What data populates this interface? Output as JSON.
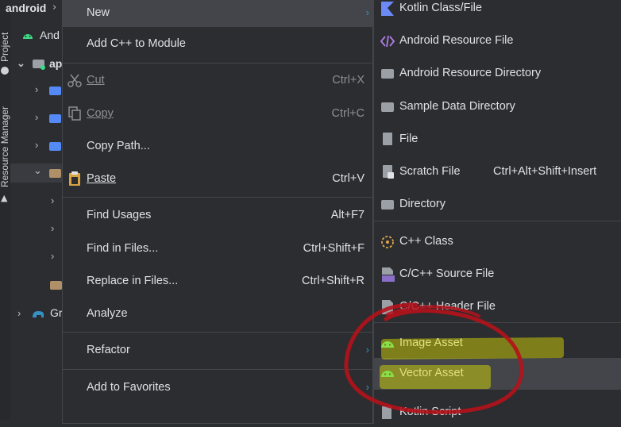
{
  "project": {
    "title": "android",
    "side_tabs": [
      "Project",
      "Resource Manager"
    ],
    "tree": [
      {
        "label": "And",
        "depth": 0,
        "icon": "android-icon"
      },
      {
        "label": "ap",
        "depth": 0,
        "icon": "module-folder-icon"
      },
      {
        "label": "",
        "depth": 1,
        "icon": "folder-icon"
      },
      {
        "label": "",
        "depth": 1,
        "icon": "folder-icon"
      },
      {
        "label": "",
        "depth": 1,
        "icon": "resource-folder-icon"
      },
      {
        "label": "",
        "depth": 1,
        "icon": "folder-icon"
      },
      {
        "label": "",
        "depth": 2,
        "icon": "folder-icon"
      },
      {
        "label": "",
        "depth": 2,
        "icon": "folder-icon"
      },
      {
        "label": "",
        "depth": 2,
        "icon": "folder-icon"
      },
      {
        "label": "",
        "depth": 1,
        "icon": "folder-icon"
      },
      {
        "label": "Gr",
        "depth": 0,
        "icon": "gradle-icon"
      }
    ]
  },
  "context_menu": {
    "items": [
      {
        "label": "New",
        "shortcut": "",
        "submenu": true,
        "highlighted": true
      },
      {
        "label": "Add C++ to Module",
        "shortcut": ""
      },
      {
        "label": "Cut",
        "shortcut": "Ctrl+X",
        "disabled": true,
        "icon": "scissors-icon"
      },
      {
        "label": "Copy",
        "shortcut": "Ctrl+C",
        "disabled": true,
        "icon": "copy-icon"
      },
      {
        "label": "Copy Path...",
        "shortcut": ""
      },
      {
        "label": "Paste",
        "shortcut": "Ctrl+V",
        "icon": "clipboard-icon"
      },
      {
        "label": "Find Usages",
        "shortcut": "Alt+F7"
      },
      {
        "label": "Find in Files...",
        "shortcut": "Ctrl+Shift+F"
      },
      {
        "label": "Replace in Files...",
        "shortcut": "Ctrl+Shift+R"
      },
      {
        "label": "Analyze",
        "shortcut": ""
      },
      {
        "label": "Refactor",
        "shortcut": "",
        "submenu": true
      },
      {
        "label": "Add to Favorites",
        "shortcut": "",
        "submenu": true
      }
    ]
  },
  "new_submenu": {
    "items": [
      {
        "label": "Kotlin Class/File",
        "shortcut": "",
        "icon": "kotlin-icon"
      },
      {
        "label": "Android Resource File",
        "shortcut": "",
        "icon": "code-brackets-icon"
      },
      {
        "label": "Android Resource Directory",
        "shortcut": "",
        "icon": "folder-icon"
      },
      {
        "label": "Sample Data Directory",
        "shortcut": "",
        "icon": "folder-icon"
      },
      {
        "label": "File",
        "shortcut": "",
        "icon": "file-icon"
      },
      {
        "label": "Scratch File",
        "shortcut": "Ctrl+Alt+Shift+Insert",
        "icon": "scratch-file-icon"
      },
      {
        "label": "Directory",
        "shortcut": "",
        "icon": "folder-icon"
      },
      {
        "label": "C++ Class",
        "shortcut": "",
        "icon": "cpp-class-icon"
      },
      {
        "label": "C/C++ Source File",
        "shortcut": "",
        "icon": "cpp-source-icon"
      },
      {
        "label": "C/C++ Header File",
        "shortcut": "",
        "icon": "cpp-header-icon"
      },
      {
        "label": "Image Asset",
        "shortcut": "",
        "icon": "android-icon"
      },
      {
        "label": "Vector Asset",
        "shortcut": "",
        "icon": "android-icon",
        "highlighted": true
      },
      {
        "label": "Kotlin Script",
        "shortcut": "",
        "icon": "kotlin-script-icon"
      }
    ]
  },
  "colors": {
    "background": "#2b2d30",
    "highlight": "#43454a",
    "submenu_arrow": "#3592c4",
    "annotation_marker": "#e5e500",
    "annotation_circle": "#b5121b",
    "android_green": "#3ddc84",
    "kotlin_blue": "#6b8af5"
  }
}
